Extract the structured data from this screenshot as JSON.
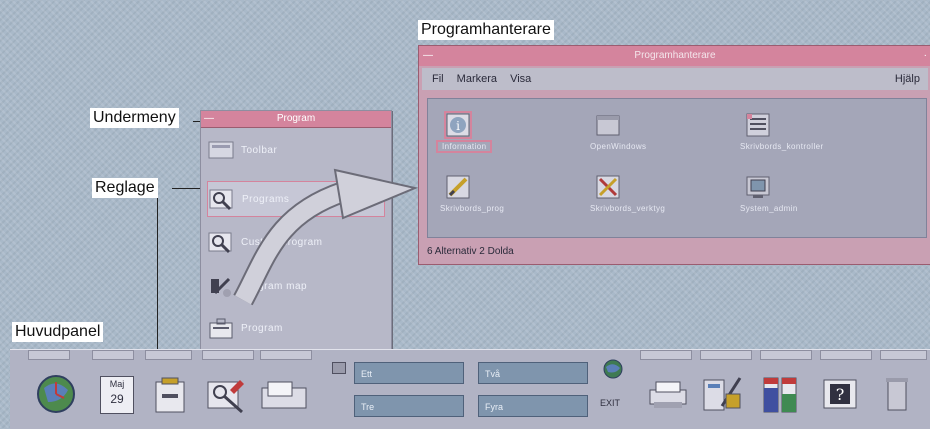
{
  "callouts": {
    "programhanterare": "Programhanterare",
    "undermeny": "Undermeny",
    "reglage": "Reglage",
    "huvudpanel": "Huvudpanel"
  },
  "submenu": {
    "title": "Program",
    "items": [
      {
        "label": "Toolbar",
        "icon": "install-icon"
      },
      {
        "label": "Programs",
        "icon": "magnifier-icon"
      },
      {
        "label": "Custom program",
        "icon": "magnifier-icon"
      },
      {
        "label": "Program map",
        "icon": "tools-icon"
      },
      {
        "label": "Program",
        "icon": "briefcase-icon"
      }
    ]
  },
  "window": {
    "title": "Programhanterare",
    "menu": {
      "file": "Fil",
      "select": "Markera",
      "view": "Visa",
      "help": "Hjälp"
    },
    "icons": [
      {
        "label": "Information",
        "icon": "info-icon"
      },
      {
        "label": "OpenWindows",
        "icon": "folder-icon"
      },
      {
        "label": "Skrivbords_kontroller",
        "icon": "desk-control-icon"
      },
      {
        "label": "Skrivbords_prog",
        "icon": "desk-prog-icon"
      },
      {
        "label": "Skrivbords_verktyg",
        "icon": "desk-tools-icon"
      },
      {
        "label": "System_admin",
        "icon": "system-admin-icon"
      }
    ],
    "status": "6 Alternativ 2 Dolda"
  },
  "panel": {
    "workspaces": [
      "Ett",
      "Två",
      "Tre",
      "Fyra"
    ],
    "date": {
      "month": "Maj",
      "day": "29"
    },
    "exit": "EXIT"
  },
  "colors": {
    "accent": "#d4849d",
    "background": "#a9b9c9",
    "panel": "#b1b3c4",
    "workspace": "#7f95ad"
  }
}
